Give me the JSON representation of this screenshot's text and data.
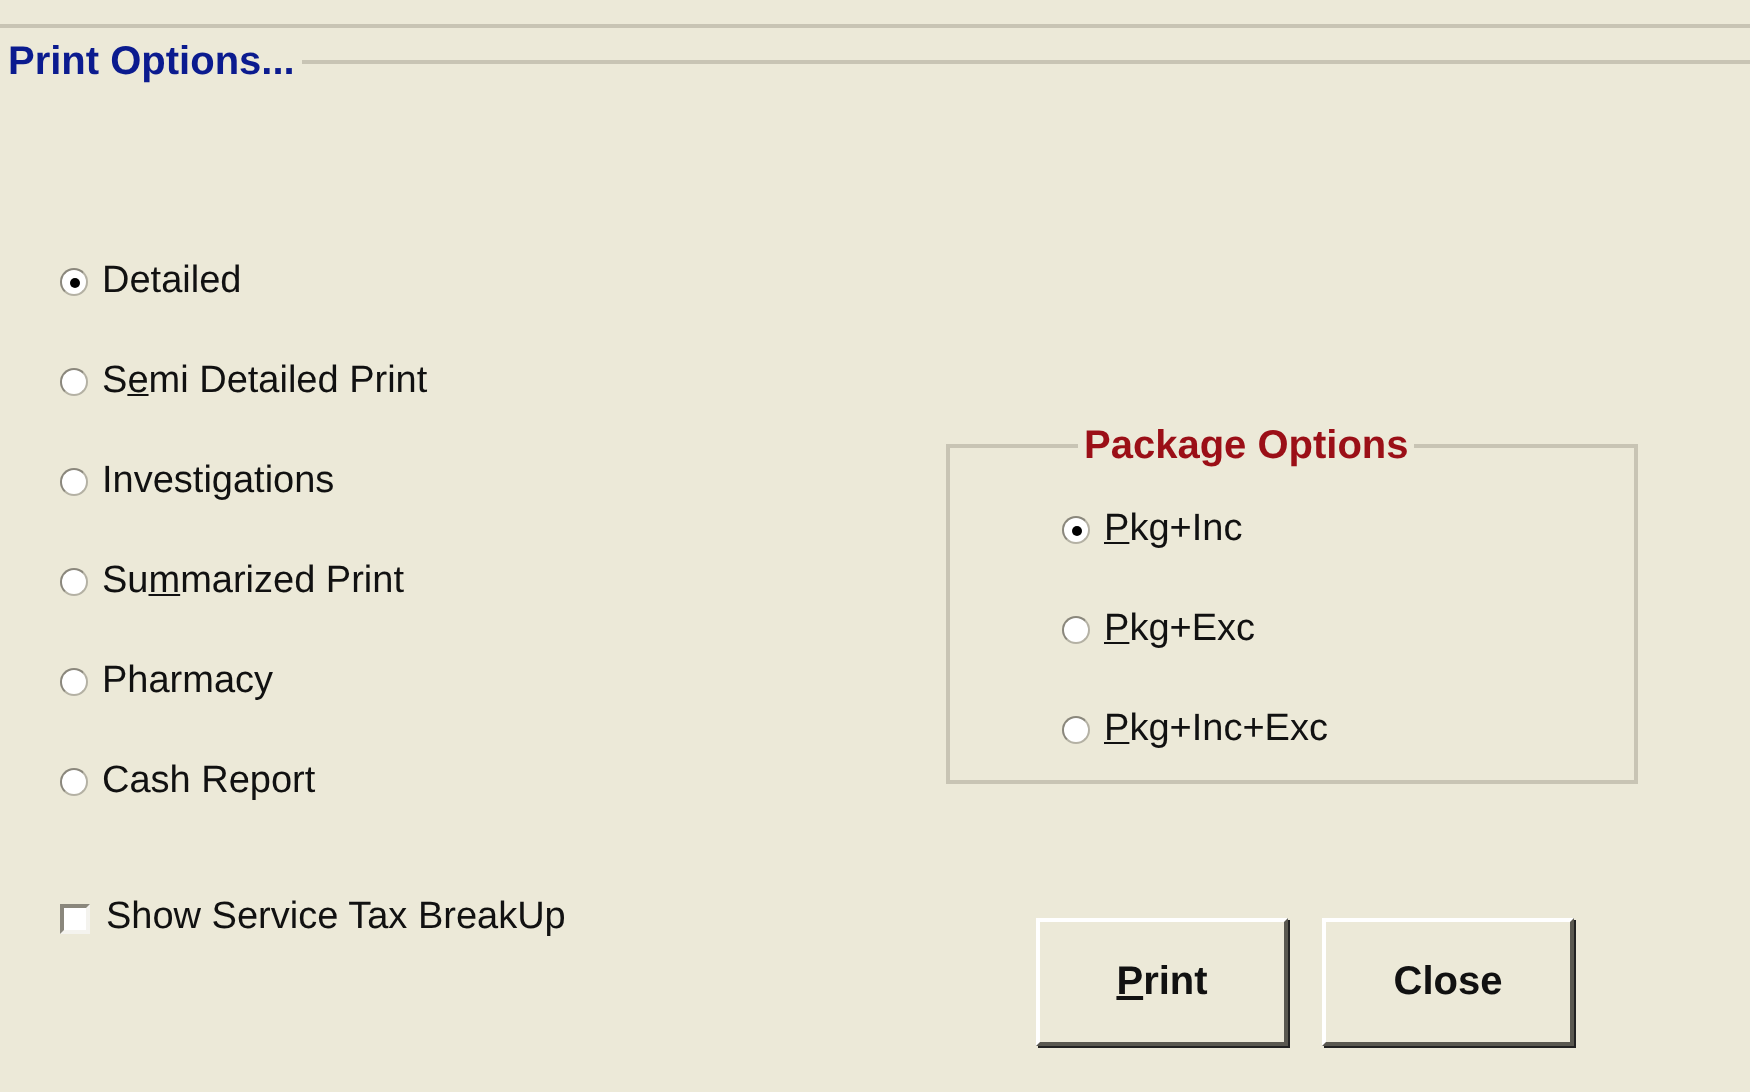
{
  "print_options": {
    "title": "Print Options...",
    "options": [
      {
        "label": {
          "after": "Detailed"
        },
        "selected": true
      },
      {
        "label": {
          "before": "S",
          "key": "e",
          "after": "mi Detailed Print"
        },
        "selected": false
      },
      {
        "label": {
          "after": "Investigations"
        },
        "selected": false
      },
      {
        "label": {
          "before": "Su",
          "key": "m",
          "after": "marized Print"
        },
        "selected": false
      },
      {
        "label": {
          "after": "Pharmacy"
        },
        "selected": false
      },
      {
        "label": {
          "after": "Cash Report"
        },
        "selected": false
      }
    ],
    "show_service_tax": {
      "label": "Show Service Tax BreakUp",
      "checked": false
    }
  },
  "package_options": {
    "title": "Package Options",
    "options": [
      {
        "label": {
          "key": "P",
          "after": "kg+Inc"
        },
        "selected": true
      },
      {
        "label": {
          "key": "P",
          "after": "kg+Exc"
        },
        "selected": false
      },
      {
        "label": {
          "key": "P",
          "after": "kg+Inc+Exc"
        },
        "selected": false
      }
    ]
  },
  "buttons": [
    {
      "label": {
        "key": "P",
        "after": "rint"
      }
    },
    {
      "label": {
        "after": "Close"
      }
    }
  ]
}
